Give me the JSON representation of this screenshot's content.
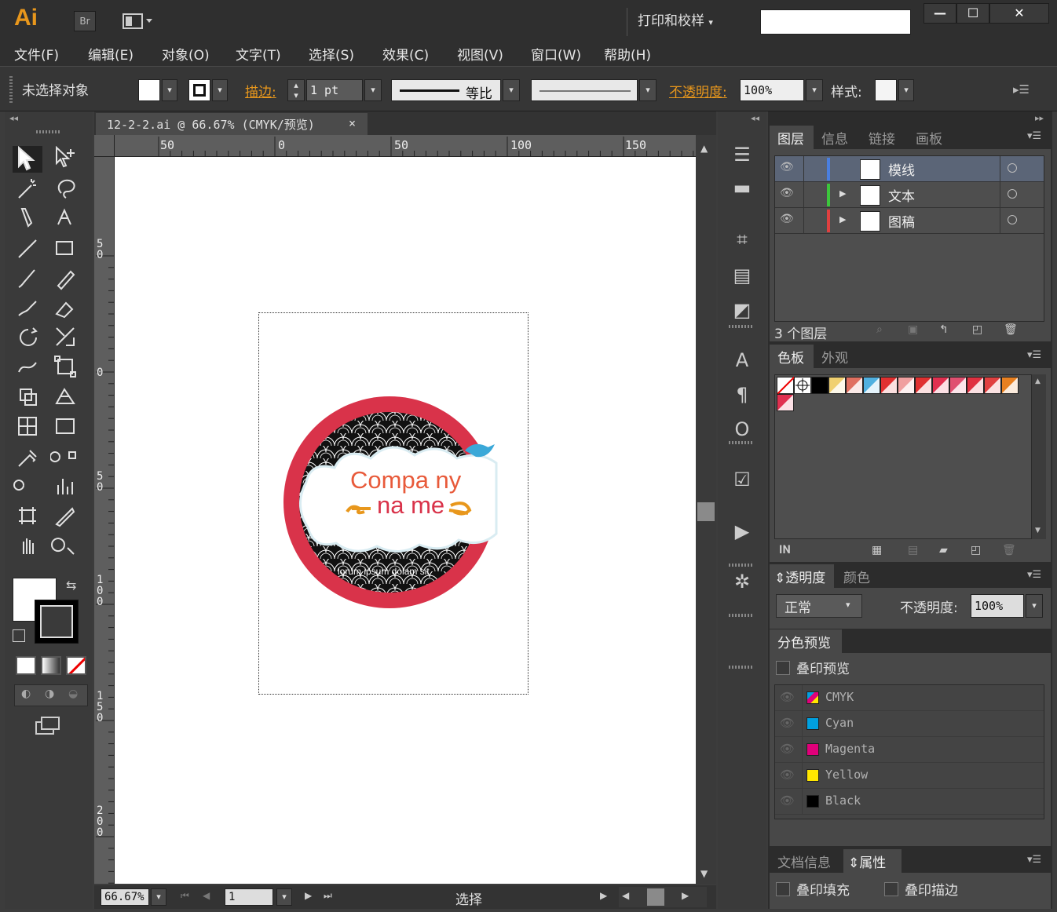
{
  "app": {
    "logo": "Ai",
    "br_label": "Br",
    "workspace": "打印和校样",
    "search_value": ""
  },
  "window": {
    "minimize": "—",
    "maximize": "☐",
    "close": "✕"
  },
  "menu": [
    "文件(F)",
    "编辑(E)",
    "对象(O)",
    "文字(T)",
    "选择(S)",
    "效果(C)",
    "视图(V)",
    "窗口(W)",
    "帮助(H)"
  ],
  "control": {
    "no_selection": "未选择对象",
    "stroke_label": "描边:",
    "stroke_weight": "1 pt",
    "profile": "等比",
    "opacity_label": "不透明度:",
    "opacity_value": "100%",
    "style_label": "样式:"
  },
  "document": {
    "tab_title": "12-2-2.ai @ 66.67% (CMYK/预览)",
    "tab_close": "×",
    "ruler_top": [
      "50",
      "0",
      "50",
      "100",
      "150"
    ],
    "ruler_left": [
      "5\n0",
      "0",
      "5\n0",
      "1\n0\n0",
      "1\n5\n0",
      "2\n0\n0"
    ],
    "artwork": {
      "company": "Compa ny",
      "name": "na me",
      "tagline": "lorum ipsum dolam sit"
    }
  },
  "status": {
    "zoom": "66.67%",
    "page": "1",
    "tool": "选择"
  },
  "layers_panel": {
    "tabs": [
      "图层",
      "信息",
      "链接",
      "画板"
    ],
    "layers": [
      {
        "name": "模线",
        "color": "#4a7fe0"
      },
      {
        "name": "文本",
        "color": "#3cc63c"
      },
      {
        "name": "图稿",
        "color": "#e04040"
      }
    ],
    "count": "3 个图层"
  },
  "swatches_panel": {
    "tabs": [
      "色板",
      "外观"
    ],
    "colors": [
      "#ffffff",
      "#000000",
      "#000000",
      "#f0d070",
      "#e07060",
      "#50b0e0",
      "#e03030",
      "#f0a0a0",
      "#e03030",
      "#e03050",
      "#e05070",
      "#e03040",
      "#e04040",
      "#e88020",
      "#e03050"
    ]
  },
  "transparency_panel": {
    "tabs": [
      "透明度",
      "颜色"
    ],
    "mode": "正常",
    "opacity_label": "不透明度:",
    "opacity_value": "100%"
  },
  "separations_panel": {
    "title": "分色预览",
    "overprint": "叠印预览",
    "plates": [
      {
        "name": "CMYK",
        "color": "#888888"
      },
      {
        "name": "Cyan",
        "color": "#00a0e0"
      },
      {
        "name": "Magenta",
        "color": "#e0007a"
      },
      {
        "name": "Yellow",
        "color": "#ffe600"
      },
      {
        "name": "Black",
        "color": "#000000"
      }
    ]
  },
  "attributes_panel": {
    "tabs": [
      "文档信息",
      "属性"
    ],
    "overprint_fill": "叠印填充",
    "overprint_stroke": "叠印描边"
  }
}
